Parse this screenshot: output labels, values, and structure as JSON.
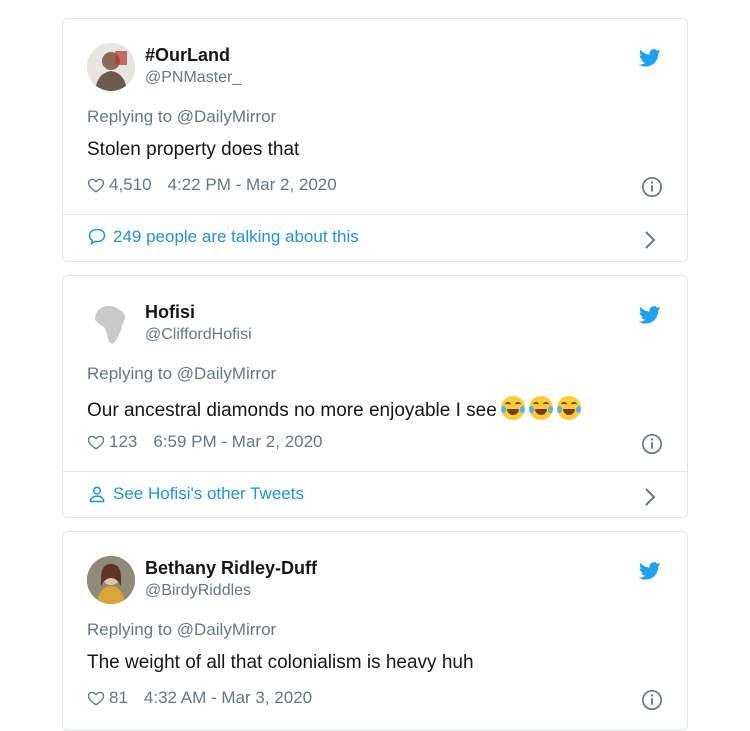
{
  "colors": {
    "link": "#1b95e0",
    "muted": "#657786",
    "text": "#14171a",
    "twitter_blue": "#1da1f2",
    "border": "#e1e8ed"
  },
  "tweets": [
    {
      "name": "#OurLand",
      "handle": "@PNMaster_",
      "reply": "Replying to @DailyMirror",
      "text": "Stolen property does that",
      "likes": "4,510",
      "time": "4:22 PM - Mar 2, 2020",
      "footer_icon": "comment-icon",
      "footer": "249 people are talking about this"
    },
    {
      "name": "Hofisi",
      "handle": "@CliffordHofisi",
      "reply": "Replying to @DailyMirror",
      "text": "Our ancestral diamonds no more enjoyable I see",
      "emoji_count": 3,
      "likes": "123",
      "time": "6:59 PM - Mar 2, 2020",
      "footer_icon": "person-icon",
      "footer": "See Hofisi's other Tweets"
    },
    {
      "name": "Bethany Ridley-Duff",
      "handle": "@BirdyRiddles",
      "reply": "Replying to @DailyMirror",
      "text": "The weight of all that colonialism is heavy huh",
      "likes": "81",
      "time": "4:32 AM - Mar 3, 2020"
    }
  ]
}
